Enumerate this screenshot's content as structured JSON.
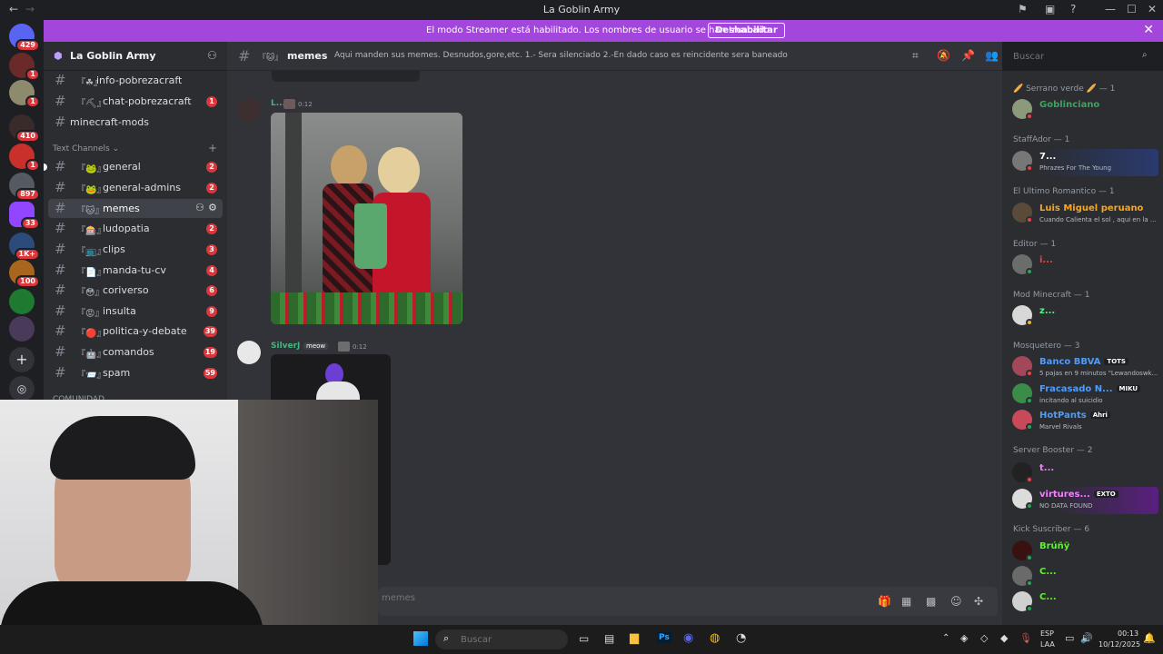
{
  "window": {
    "title": "La Goblin Army"
  },
  "banner": {
    "message": "El modo Streamer está habilitado. Los nombres de usuario se han truncado.",
    "button": "Deshabilitar"
  },
  "servers": [
    {
      "badge": "429"
    },
    {
      "badge": "1"
    },
    {
      "badge": "1"
    },
    {
      "badge": "410"
    },
    {
      "badge": "1"
    },
    {
      "badge": "897"
    },
    {
      "badge": "33"
    },
    {
      "badge": "1K+"
    },
    {
      "badge": "100"
    },
    {
      "badge": ""
    },
    {
      "badge": ""
    }
  ],
  "sidebar": {
    "server_name": "La Goblin Army",
    "top_channels": [
      {
        "emoji": "『☘』",
        "name": "info-pobrezacraft",
        "count": ""
      },
      {
        "emoji": "『⛏』",
        "name": "chat-pobrezacraft",
        "count": "1"
      },
      {
        "emoji": "",
        "name": "minecraft-mods",
        "count": ""
      }
    ],
    "category": "Text Channels",
    "channels": [
      {
        "emoji": "『🐸』",
        "name": "general",
        "count": "2"
      },
      {
        "emoji": "『🐸』",
        "name": "general-admins",
        "count": "2"
      },
      {
        "emoji": "『🐱』",
        "name": "memes",
        "count": ""
      },
      {
        "emoji": "『🎰』",
        "name": "ludopatia",
        "count": "2"
      },
      {
        "emoji": "『📺』",
        "name": "clips",
        "count": "3"
      },
      {
        "emoji": "『📄』",
        "name": "manda-tu-cv",
        "count": "4"
      },
      {
        "emoji": "『😳』",
        "name": "coriverso",
        "count": "6"
      },
      {
        "emoji": "『😡』",
        "name": "insulta",
        "count": "9"
      },
      {
        "emoji": "『🔴』",
        "name": "politica-y-debate",
        "count": "39"
      },
      {
        "emoji": "『🤖』",
        "name": "comandos",
        "count": "19"
      },
      {
        "emoji": "『📨』",
        "name": "spam",
        "count": "59"
      }
    ],
    "category2": "COMUNIDAD"
  },
  "chat": {
    "channel_emoji": "『🐱』",
    "channel_name": "memes",
    "topic": "Aqui manden sus memes. Desnudos,gore,etc. 1.- Sera silenciado 2.-En dado caso es reincidente sera baneado",
    "messages": [
      {
        "author": "L...",
        "time": "0:12",
        "color": "#43b581"
      },
      {
        "author": "SilverJ",
        "tag": "meow",
        "time": "0:12",
        "color": "#43b581"
      }
    ],
    "composer_placeholder": "memes"
  },
  "search": {
    "placeholder": "Buscar"
  },
  "members": {
    "groups": [
      {
        "header": "🥖 Serrano verde 🥖 — 1",
        "members": [
          {
            "name": "Goblinciano",
            "sub": "",
            "color": "#3ba55d",
            "tag": ""
          }
        ]
      },
      {
        "header": "StaffAdor — 1",
        "members": [
          {
            "name": "7...",
            "sub": "Phrazes For The Young",
            "color": "#ffffff",
            "tag": ""
          }
        ]
      },
      {
        "header": "El Ultimo Romantico — 1",
        "members": [
          {
            "name": "Luis Miguel peruano",
            "sub": "Cuando Calienta el sol , aqui en la ...",
            "color": "#faa61a",
            "tag": ""
          }
        ]
      },
      {
        "header": "Editor — 1",
        "members": [
          {
            "name": "i...",
            "sub": "",
            "color": "#ed4245",
            "tag": ""
          }
        ]
      },
      {
        "header": "Mod Minecraft — 1",
        "members": [
          {
            "name": "z...",
            "sub": "",
            "color": "#57f287",
            "tag": ""
          }
        ]
      },
      {
        "header": "Mosquetero — 3",
        "members": [
          {
            "name": "Banco BBVA",
            "sub": "5 pajas en 9 minutos \"Lewandoswk...",
            "color": "#4f9cf9",
            "tag": "TOTS"
          },
          {
            "name": "Fracasado N...",
            "sub": "incitando al suicidio",
            "color": "#4f9cf9",
            "tag": "MIKU"
          },
          {
            "name": "HotPants",
            "sub": "Marvel Rivals",
            "color": "#4f9cf9",
            "tag": "Ahri"
          }
        ]
      },
      {
        "header": "Server Booster — 2",
        "members": [
          {
            "name": "t...",
            "sub": "",
            "color": "#f47fff",
            "tag": ""
          },
          {
            "name": "virtures...",
            "sub": "NO DATA FOUND",
            "color": "#f47fff",
            "tag": "EXTO"
          }
        ]
      },
      {
        "header": "Kick Suscriber — 6",
        "members": [
          {
            "name": "Brúñÿ",
            "sub": "",
            "color": "#53fc18",
            "tag": ""
          },
          {
            "name": "C...",
            "sub": "",
            "color": "#53fc18",
            "tag": ""
          },
          {
            "name": "C...",
            "sub": "",
            "color": "#53fc18",
            "tag": ""
          }
        ]
      }
    ]
  },
  "taskbar": {
    "search": "Buscar",
    "lang": "ESP",
    "layout": "LAA",
    "time": "00:13",
    "date": "10/12/2025"
  }
}
